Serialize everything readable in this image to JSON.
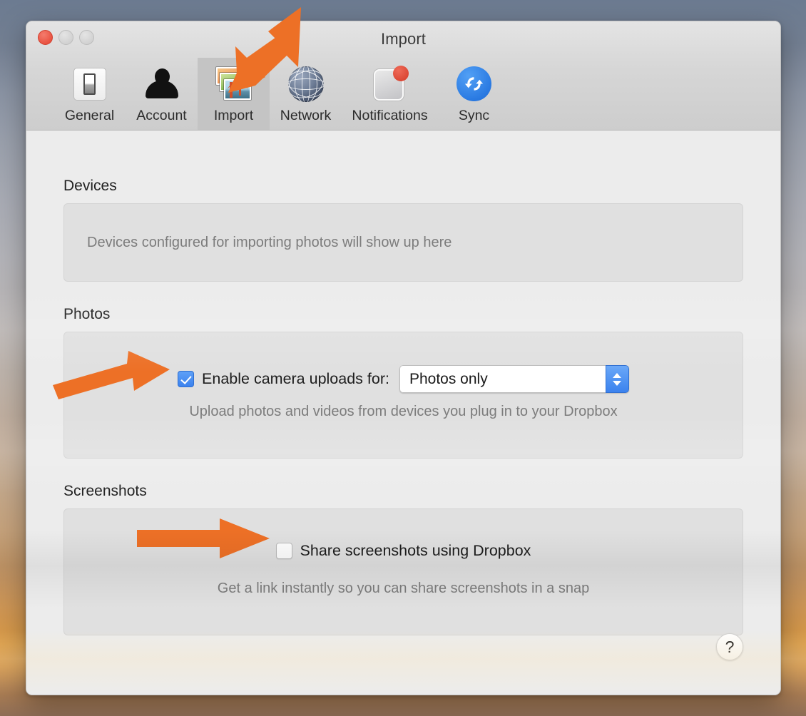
{
  "window": {
    "title": "Import",
    "traffic_lights": [
      "close-button",
      "minimize-button",
      "maximize-button"
    ]
  },
  "toolbar": {
    "items": [
      {
        "label": "General",
        "icon": "toggle-switch-icon",
        "selected": false
      },
      {
        "label": "Account",
        "icon": "person-icon",
        "selected": false
      },
      {
        "label": "Import",
        "icon": "photo-stack-icon",
        "selected": true
      },
      {
        "label": "Network",
        "icon": "globe-icon",
        "selected": false
      },
      {
        "label": "Notifications",
        "icon": "notification-card-icon",
        "selected": false
      },
      {
        "label": "Sync",
        "icon": "sync-arrows-icon",
        "selected": false
      }
    ]
  },
  "sections": {
    "devices": {
      "title": "Devices",
      "empty_text": "Devices configured for importing photos will show up here"
    },
    "photos": {
      "title": "Photos",
      "checkbox_label": "Enable camera uploads for:",
      "checkbox_checked": "checked",
      "dropdown_value": "Photos only",
      "description": "Upload photos and videos from devices you plug in to your Dropbox"
    },
    "screenshots": {
      "title": "Screenshots",
      "checkbox_label": "Share screenshots using Dropbox",
      "checkbox_checked": "unchecked",
      "description": "Get a link instantly so you can share screenshots in a snap"
    }
  },
  "help": {
    "glyph": "?"
  },
  "annotations": {
    "color": "#ED7026",
    "arrows": [
      {
        "name": "arrow-to-import-tab",
        "direction": "down-left"
      },
      {
        "name": "arrow-to-camera-uploads-checkbox",
        "direction": "right-up"
      },
      {
        "name": "arrow-to-share-screenshots-checkbox",
        "direction": "right"
      }
    ]
  }
}
